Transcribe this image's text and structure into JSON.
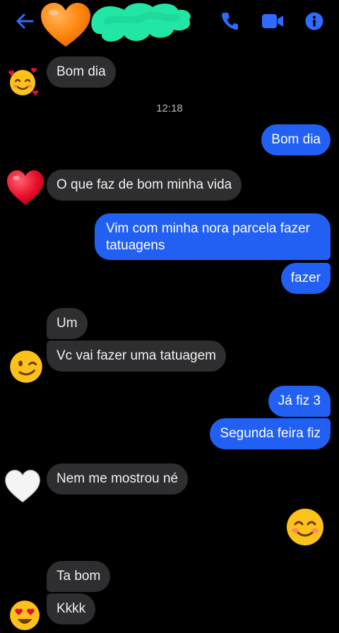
{
  "header": {
    "back_icon": "arrow-left-icon",
    "avatar_icon": "orange-heart-icon",
    "contact_name_scribble_color": "#22e6a6",
    "call_icon": "phone-icon",
    "video_icon": "video-camera-icon",
    "info_icon": "info-icon",
    "accent_color": "#2f6bff"
  },
  "messages": [
    {
      "side": "in",
      "text": "Bom dia"
    },
    {
      "timestamp": "12:18"
    },
    {
      "side": "out",
      "text": "Bom dia"
    },
    {
      "side": "in",
      "text": "O que faz de bom minha vida"
    },
    {
      "side": "out",
      "text_lines": [
        "Vim com minha nora parcela fazer",
        "tatuagens"
      ]
    },
    {
      "side": "out",
      "text": "fazer"
    },
    {
      "side": "in",
      "text": "Um"
    },
    {
      "side": "in",
      "text": "Vc vai fazer uma tatuagem"
    },
    {
      "side": "out",
      "text": "Já fiz 3"
    },
    {
      "side": "out",
      "text": "Segunda feira fiz"
    },
    {
      "side": "in",
      "text": "Nem me mostrou né"
    },
    {
      "side": "out",
      "emoji": "smiling-blush-emoji"
    },
    {
      "side": "in",
      "text": "Ta bom"
    },
    {
      "side": "in",
      "text": "Kkkk"
    }
  ],
  "reactions": {
    "r1": "smiling-hearts-emoji",
    "r2": "red-heart-emoji",
    "r3": "wink-emoji",
    "r4": "white-heart-emoji",
    "r5": "heart-eyes-emoji"
  },
  "colors": {
    "incoming_bubble": "#2e2e30",
    "outgoing_bubble": "#2160f3",
    "background": "#000000"
  }
}
